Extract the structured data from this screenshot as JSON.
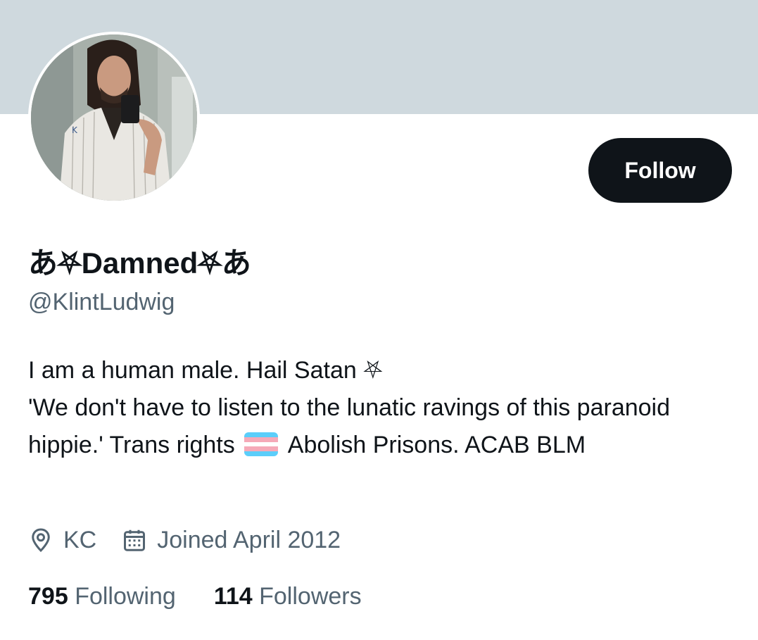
{
  "banner": {
    "color": "#cfd9de"
  },
  "profile": {
    "display_name": "あ⛧Damned⛧あ",
    "handle": "@KlintLudwig",
    "avatar_icon": "profile-photo"
  },
  "actions": {
    "follow_label": "Follow"
  },
  "bio": {
    "line1": "I am a human male. Hail Satan ⛧",
    "line2_start": "'We don't have to listen to the lunatic ravings of this paranoid hippie.' Trans rights",
    "flag_icon": "transgender-flag-emoji",
    "line2_end": "Abolish Prisons. ACAB BLM"
  },
  "meta": {
    "location": "KC",
    "location_icon": "location-pin-icon",
    "joined": "Joined April 2012",
    "joined_icon": "calendar-icon"
  },
  "stats": {
    "following_count": "795",
    "following_label": "Following",
    "followers_count": "114",
    "followers_label": "Followers"
  },
  "colors": {
    "text_primary": "#0f1419",
    "text_secondary": "#536471",
    "button_bg": "#0f1419",
    "flag_blue": "#5bcefa",
    "flag_pink": "#f5a9b8",
    "flag_white": "#ffffff"
  }
}
